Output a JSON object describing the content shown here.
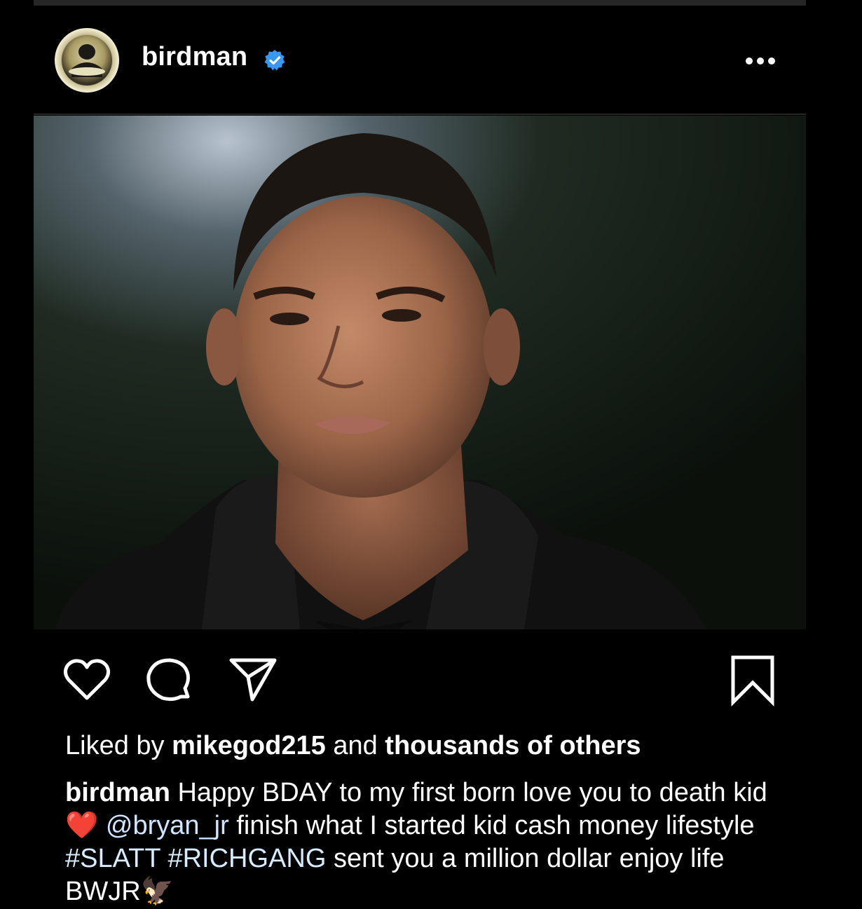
{
  "post": {
    "username": "birdman",
    "verified": true,
    "likes": {
      "prefix": "Liked by",
      "user": "mikegod215",
      "middle": "and",
      "suffix": "thousands of others"
    },
    "caption": {
      "author": "birdman",
      "text_1": "Happy BDAY to my first born love you to death kid",
      "heart_emoji": "❤️",
      "mention": "@bryan_jr",
      "text_2": "finish what I started kid cash money lifestyle",
      "hashtag_1": "#SLATT",
      "hashtag_2": "#RICHGANG",
      "text_3": "sent you a million dollar enjoy life BWJR",
      "eagle_emoji": "🦅"
    }
  },
  "icons": {
    "more": "more-options-icon",
    "like": "heart-icon",
    "comment": "comment-icon",
    "share": "paper-plane-icon",
    "save": "bookmark-icon",
    "verified": "verified-badge-icon"
  },
  "colors": {
    "background": "#000000",
    "verified": "#3897f0",
    "link": "#e0f1ff"
  }
}
